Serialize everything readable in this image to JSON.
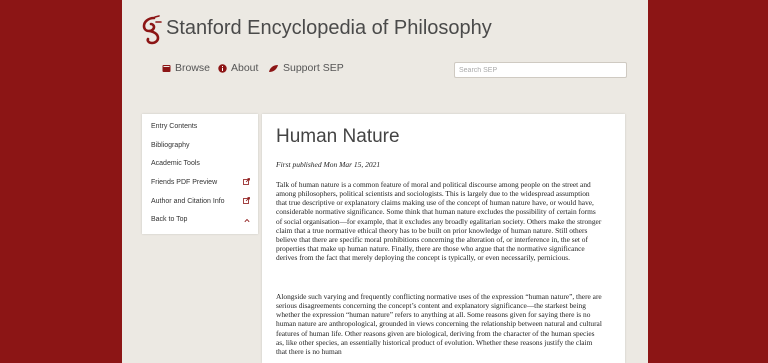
{
  "site": {
    "title": "Stanford Encyclopedia of Philosophy"
  },
  "nav": {
    "browse": "Browse",
    "about": "About",
    "support": "Support SEP"
  },
  "search": {
    "placeholder": "Search SEP"
  },
  "sidebar": {
    "items": [
      {
        "label": "Entry Contents"
      },
      {
        "label": "Bibliography"
      },
      {
        "label": "Academic Tools"
      },
      {
        "label": "Friends PDF Preview"
      },
      {
        "label": "Author and Citation Info"
      },
      {
        "label": "Back to Top"
      }
    ]
  },
  "article": {
    "title": "Human Nature",
    "pubdate": "First published Mon Mar 15, 2021",
    "para1": "Talk of human nature is a common feature of moral and political discourse among people on the street and among philosophers, political scientists and sociologists. This is largely due to the widespread assumption that true descriptive or explanatory claims making use of the concept of human nature have, or would have, considerable normative significance. Some think that human nature excludes the possibility of certain forms of social organisation—for example, that it excludes any broadly egalitarian society. Others make the stronger claim that a true normative ethical theory has to be built on prior knowledge of human nature. Still others believe that there are specific moral prohibitions concerning the alteration of, or interference in, the set of properties that make up human nature. Finally, there are those who argue that the normative significance derives from the fact that merely deploying the concept is typically, or even necessarily, pernicious.",
    "para2": "Alongside such varying and frequently conflicting normative uses of the expression “human nature”, there are serious disagreements concerning the concept’s content and explanatory significance—the starkest being whether the expression “human nature” refers to anything at all. Some reasons given for saying there is no human nature are anthropological, grounded in views concerning the relationship between natural and cultural features of human life. Other reasons given are biological, deriving from the character of the human species as, like other species, an essentially historical product of evolution. Whether these reasons justify the claim that there is no human"
  },
  "colors": {
    "brand": "#8c1515",
    "page": "#ece9e3"
  }
}
